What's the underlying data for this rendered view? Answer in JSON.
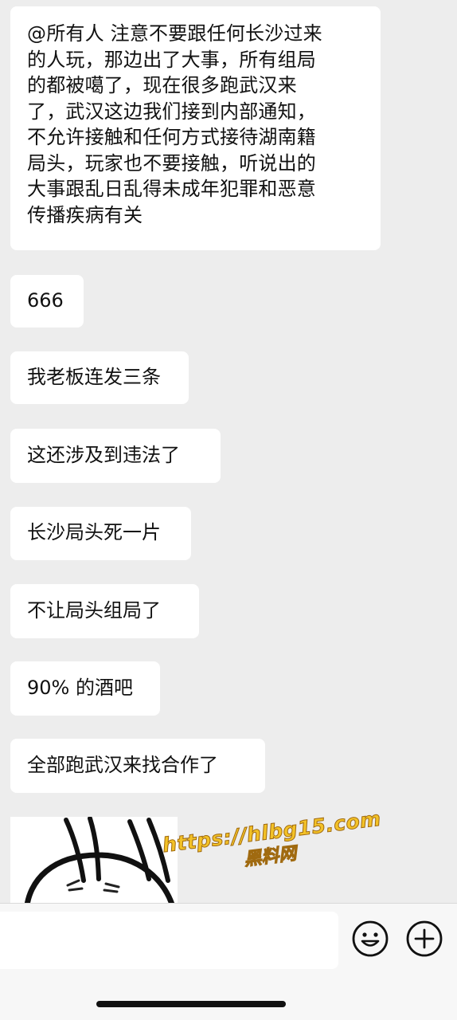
{
  "messages": [
    "@所有人 注意不要跟任何长沙过来\n的人玩，那边出了大事，所有组局\n的都被噶了，现在很多跑武汉来\n了，武汉这边我们接到内部通知，\n不允许接触和任何方式接待湖南籍\n局头，玩家也不要接触，听说出的\n大事跟乱日乱得未成年犯罪和恶意\n传播疾病有关",
    "666",
    "我老板连发三条",
    "这还涉及到违法了",
    "长沙局头死一片",
    "不让局头组局了",
    "90% 的酒吧",
    "全部跑武汉来找合作了"
  ],
  "watermark": {
    "url": "https://hlbg15.com",
    "name": "黑料网"
  },
  "input": {
    "value": ""
  },
  "icons": {
    "emoji": "smiley-face-icon",
    "plus": "plus-circle-icon"
  },
  "colors": {
    "background": "#ededed",
    "bubble": "#ffffff",
    "watermark_fill": "#f3c227",
    "watermark_stroke": "#a06a10"
  }
}
